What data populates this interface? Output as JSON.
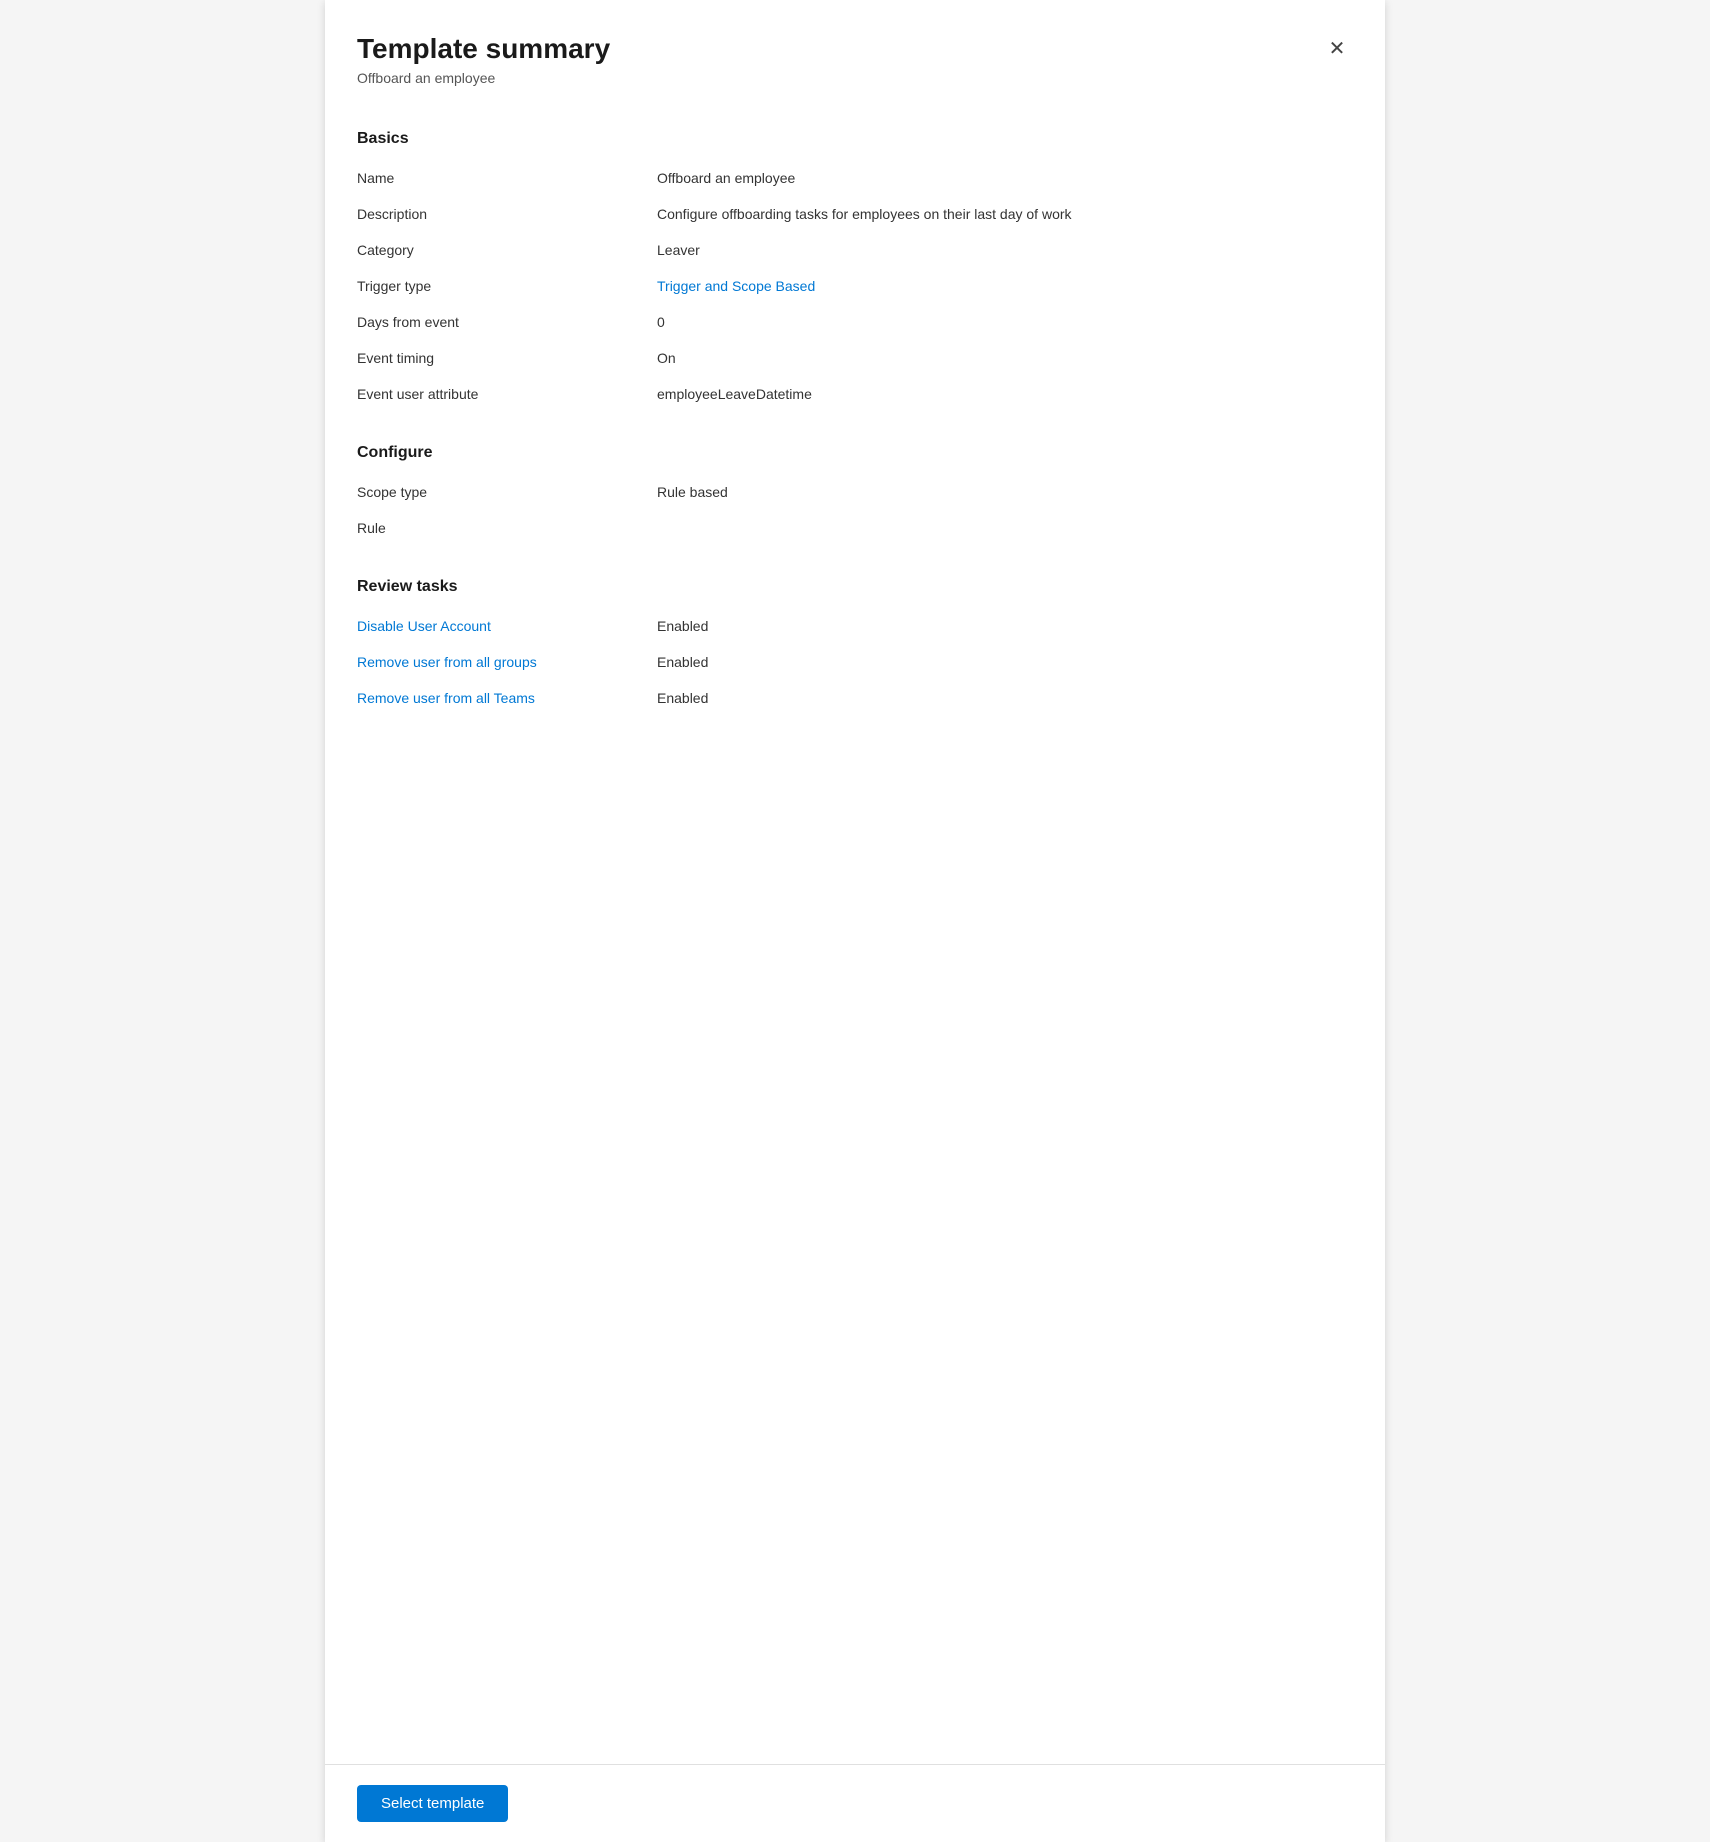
{
  "header": {
    "title": "Template summary",
    "subtitle": "Offboard an employee",
    "close_label": "×"
  },
  "sections": {
    "basics": {
      "title": "Basics",
      "fields": [
        {
          "label": "Name",
          "value": "Offboard an employee",
          "link": false
        },
        {
          "label": "Description",
          "value": "Configure offboarding tasks for employees on their last day of work",
          "link": false
        },
        {
          "label": "Category",
          "value": "Leaver",
          "link": false
        },
        {
          "label": "Trigger type",
          "value": "Trigger and Scope Based",
          "link": true
        },
        {
          "label": "Days from event",
          "value": "0",
          "link": false
        },
        {
          "label": "Event timing",
          "value": "On",
          "link": false
        },
        {
          "label": "Event user attribute",
          "value": "employeeLeaveDatetime",
          "link": false
        }
      ]
    },
    "configure": {
      "title": "Configure",
      "fields": [
        {
          "label": "Scope type",
          "value": "Rule based",
          "link": false
        },
        {
          "label": "Rule",
          "value": "",
          "link": false
        }
      ]
    },
    "review_tasks": {
      "title": "Review tasks",
      "fields": [
        {
          "label": "Disable User Account",
          "value": "Enabled",
          "link": true
        },
        {
          "label": "Remove user from all groups",
          "value": "Enabled",
          "link": true
        },
        {
          "label": "Remove user from all Teams",
          "value": "Enabled",
          "link": true
        }
      ]
    }
  },
  "footer": {
    "select_template_label": "Select template"
  }
}
